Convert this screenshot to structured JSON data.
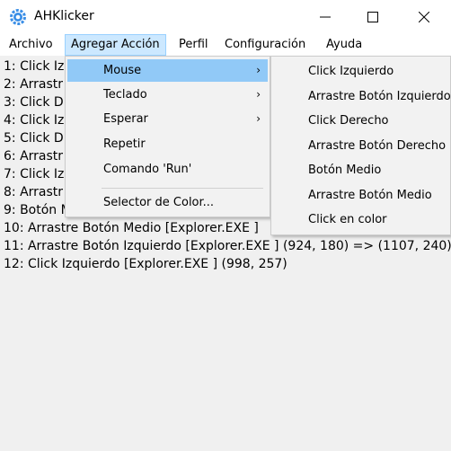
{
  "window": {
    "title": "AHKlicker",
    "icon": "gear-icon",
    "controls": [
      "minimize-icon",
      "maximize-icon",
      "close-icon"
    ]
  },
  "menubar": {
    "items": [
      "Archivo",
      "Agregar Acción",
      "Perfil",
      "Configuración",
      "Ayuda"
    ],
    "active": "Agregar Acción"
  },
  "log": {
    "lines": [
      "1: Click Iz",
      "2: Arrastr",
      "3: Click D",
      "4: Click Iz",
      "5: Click D",
      "6: Arrastr",
      "7: Click Iz",
      "8: Arrastr",
      "9: Botón M",
      "10: Arrastre Botón Medio [Explorer.EXE ]",
      "11: Arrastre Botón Izquierdo [Explorer.EXE ] (924, 180) => (1107, 240)",
      "12: Click Izquierdo [Explorer.EXE ] (998, 257)"
    ]
  },
  "dropdown": {
    "items": [
      {
        "label": "Mouse",
        "has_submenu": true,
        "highlighted": true
      },
      {
        "label": "Teclado",
        "has_submenu": true
      },
      {
        "label": "Esperar",
        "has_submenu": true
      },
      {
        "label": "Repetir",
        "has_submenu": false
      },
      {
        "label": "Comando 'Run'",
        "has_submenu": false
      },
      {
        "label": "Selector de Color...",
        "has_submenu": false
      }
    ],
    "arrow": "›"
  },
  "submenu": {
    "items": [
      "Click Izquierdo",
      "Arrastre Botón Izquierdo",
      "Click Derecho",
      "Arrastre Botón Derecho",
      "Botón Medio",
      "Arrastre Botón Medio",
      "Click en color"
    ]
  },
  "colors": {
    "menu_highlight": "#91c9f7",
    "menubar_active": "#cce8ff",
    "icon_blue": "#3a8ee6"
  }
}
